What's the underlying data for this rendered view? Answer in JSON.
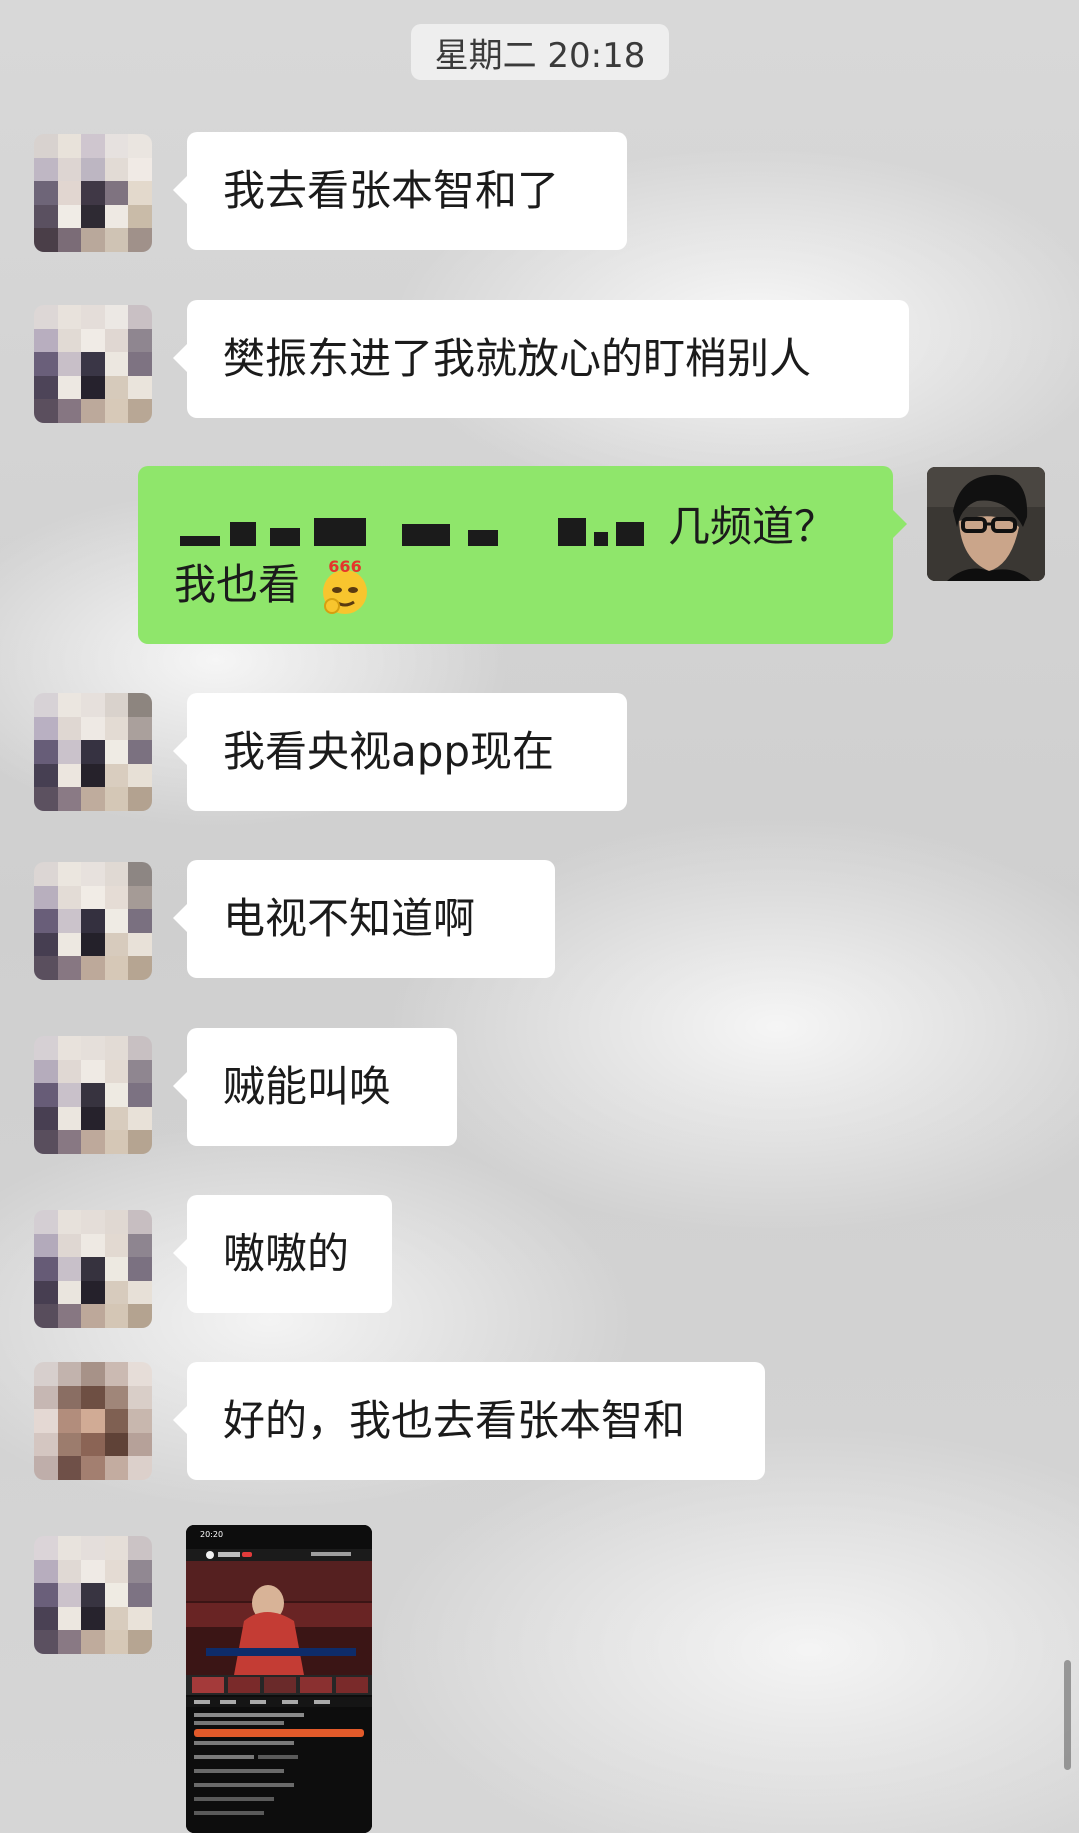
{
  "timestamp": "星期二 20:18",
  "messages": [
    {
      "text": "我去看张本智和了"
    },
    {
      "text": "樊振东进了我就放心的盯梢别人"
    },
    {
      "text": "我看央视app现在"
    },
    {
      "text": "电视不知道啊"
    },
    {
      "text": "贼能叫唤"
    },
    {
      "text": "嗷嗷的"
    },
    {
      "text": "好的，我也去看张本智和"
    }
  ],
  "my_message": {
    "line1_visible": "几频道？",
    "line2": "我也看",
    "emoji_label": "666"
  },
  "screenshot_preview": {
    "status_time": "20:20"
  },
  "colors": {
    "my_bubble": "#8fe66b",
    "their_bubble": "#ffffff"
  }
}
